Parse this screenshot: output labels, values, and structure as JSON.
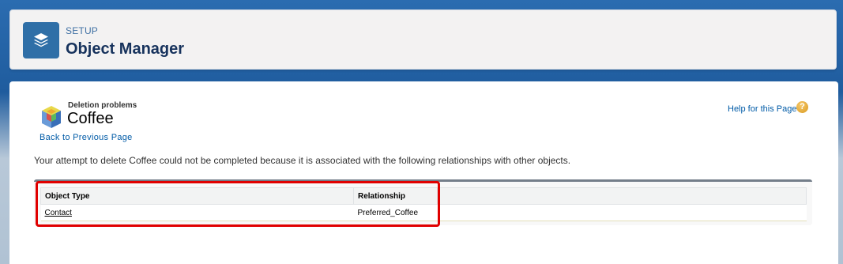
{
  "header": {
    "section_label": "SETUP",
    "title": "Object Manager",
    "icon": "layers-icon"
  },
  "record": {
    "subtitle": "Deletion problems",
    "title": "Coffee",
    "icon": "custom-object-cube-icon",
    "back_link": "Back to Previous Page",
    "help_link": "Help for this Page",
    "help_icon": "question-mark-icon",
    "help_icon_glyph": "?"
  },
  "message": "Your attempt to delete Coffee could not be completed because it is associated with the following relationships with other objects.",
  "table": {
    "columns": [
      "Object Type",
      "Relationship"
    ],
    "rows": [
      [
        "Contact",
        "Preferred_Coffee"
      ]
    ]
  },
  "colors": {
    "app_icon_bg": "#2f6fa7",
    "link": "#015ba7",
    "highlight": "#e00000"
  }
}
